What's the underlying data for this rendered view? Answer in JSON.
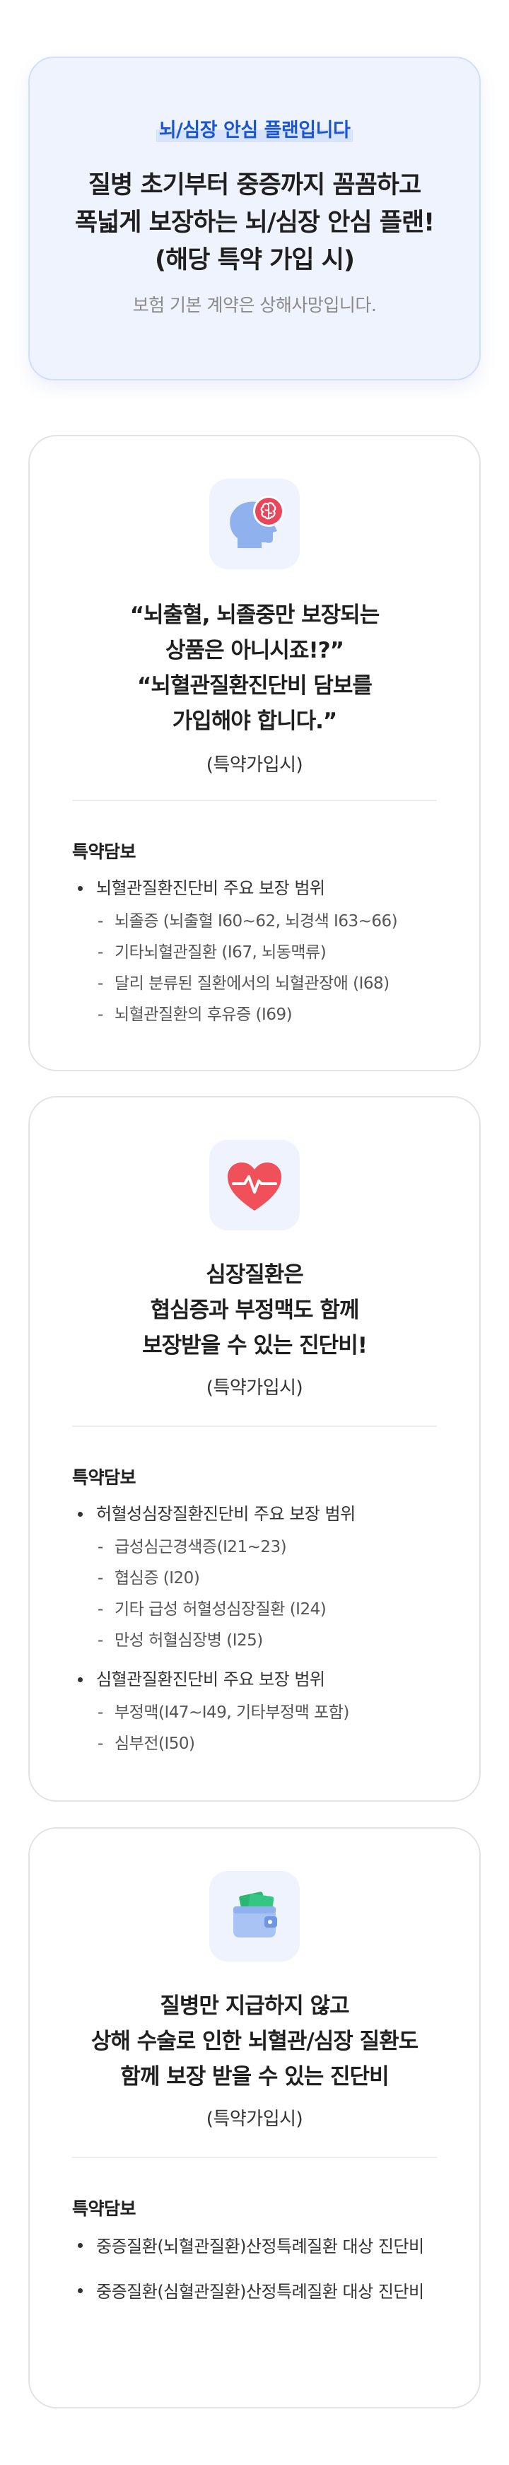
{
  "hero": {
    "tag": "뇌/심장 안심 플랜입니다",
    "title_lines": [
      "질병 초기부터 중증까지 꼼꼼하고",
      "폭넓게 보장하는 뇌/심장 안심 플랜!",
      "(해당 특약 가입 시)"
    ],
    "note": "보험 기본 계약은 상해사망입니다."
  },
  "cards": [
    {
      "icon": "brain-head-icon",
      "title_lines": [
        "“뇌출혈, 뇌졸중만 보장되는",
        "상품은 아니시죠!?”",
        "“뇌혈관질환진단비 담보를",
        "가입해야 합니다.”"
      ],
      "sub": "(특약가입시)",
      "section": "특약담보",
      "groups": [
        {
          "label": "뇌혈관질환진단비 주요 보장 범위",
          "items": [
            "뇌졸증 (뇌출혈 I60~62, 뇌경색 I63~66)",
            "기타뇌혈관질환 (I67, 뇌동맥류)",
            "달리 분류된 질환에서의 뇌혈관장애 (I68)",
            "뇌혈관질환의 후유증 (I69)"
          ]
        }
      ]
    },
    {
      "icon": "heart-pulse-icon",
      "title_lines": [
        "심장질환은",
        "협심증과 부정맥도 함께",
        "보장받을 수 있는 진단비!"
      ],
      "sub": "(특약가입시)",
      "section": "특약담보",
      "groups": [
        {
          "label": "허혈성심장질환진단비 주요 보장 범위",
          "items": [
            "급성심근경색증(I21~23)",
            "협심증 (I20)",
            "기타 급성 허혈성심장질환 (I24)",
            "만성 허혈심장병 (I25)"
          ]
        },
        {
          "label": "심혈관질환진단비 주요 보장 범위",
          "items": [
            "부정맥(I47~I49, 기타부정맥 포함)",
            "심부전(I50)"
          ]
        }
      ]
    },
    {
      "icon": "wallet-cash-icon",
      "title_lines": [
        "질병만 지급하지 않고",
        "상해 수술로 인한 뇌혈관/심장 질환도",
        "함께 보장 받을 수 있는 진단비"
      ],
      "sub": "(특약가입시)",
      "section": "특약담보",
      "groups": [
        {
          "label": "중증질환(뇌혈관질환)산정특례질환 대상 진단비",
          "items": []
        },
        {
          "label": "중증질환(심혈관질환)산정특례질환 대상 진단비",
          "items": []
        }
      ]
    }
  ],
  "colors": {
    "accent": "#1a55d6",
    "hero_bg": "#eef3fd",
    "heart": "#f0505a",
    "brain": "#e9455b",
    "head": "#8fb1ee",
    "wallet": "#a9c3f4",
    "cash": "#2bb673"
  }
}
